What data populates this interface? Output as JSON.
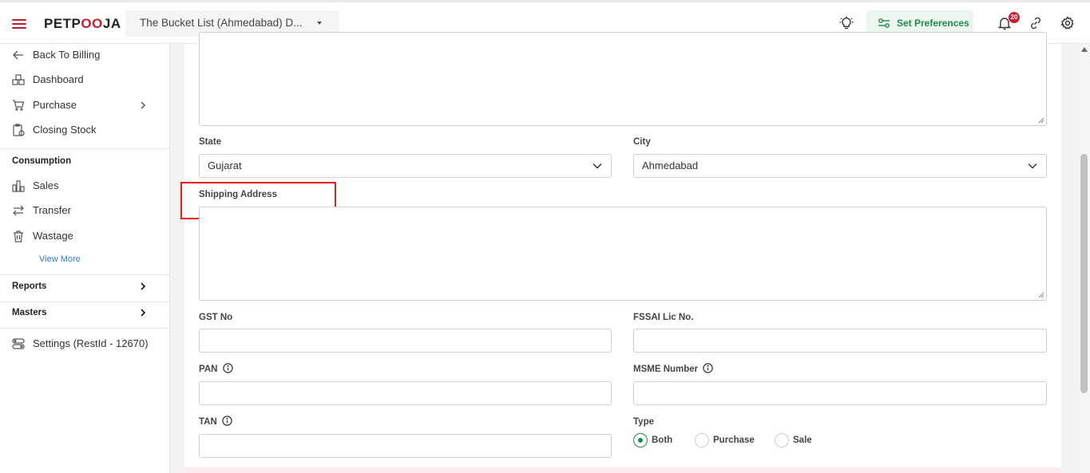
{
  "header": {
    "logo_prefix": "PETP",
    "logo_o": "OO",
    "logo_suffix": "JA",
    "outlet_name": "The Bucket List (Ahmedabad) D...",
    "preferences_label": "Set Preferences",
    "notification_count": "20",
    "accent_color": "#c8202f",
    "preferences_color": "#1f8a4c"
  },
  "sidebar": {
    "top_items": [
      {
        "label": "Back To Billing",
        "icon": "arrow-left-icon"
      },
      {
        "label": "Dashboard",
        "icon": "dashboard-icon"
      },
      {
        "label": "Purchase",
        "icon": "cart-icon"
      },
      {
        "label": "Closing Stock",
        "icon": "clipboard-icon"
      }
    ],
    "consumption_label": "Consumption",
    "consumption_items": [
      {
        "label": "Sales",
        "icon": "bar-chart-icon"
      },
      {
        "label": "Transfer",
        "icon": "transfer-icon"
      },
      {
        "label": "Wastage",
        "icon": "trash-icon"
      }
    ],
    "view_more": "View More",
    "reports_label": "Reports",
    "masters_label": "Masters",
    "settings_label": "Settings (RestId - 12670)"
  },
  "form": {
    "state_label": "State",
    "state_value": "Gujarat",
    "city_label": "City",
    "city_value": "Ahmedabad",
    "shipping_label": "Shipping Address",
    "gst_label": "GST No",
    "fssai_label": "FSSAI Lic No.",
    "pan_label": "PAN",
    "msme_label": "MSME Number",
    "tan_label": "TAN",
    "type_label": "Type",
    "type_options": [
      "Both",
      "Purchase",
      "Sale"
    ],
    "type_selected": "Both"
  }
}
